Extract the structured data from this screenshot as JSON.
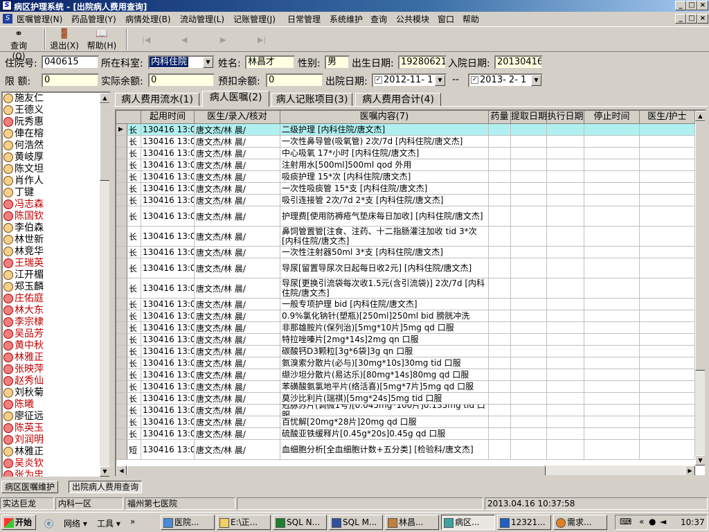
{
  "window": {
    "title": "病区护理系统 - [出院病人费用查询]",
    "controls": [
      "_",
      "□",
      "×"
    ]
  },
  "menu": [
    "医嘱管理(N)",
    "药品管理(Y)",
    "病情处理(B)",
    "流动管理(L)",
    "记账管理(J)",
    "日常管理",
    "系统维护",
    "查询",
    "公共模块",
    "窗口",
    "帮助"
  ],
  "toolbar": {
    "query": "查询(Q)",
    "exit": "退出(X)",
    "help": "帮助(H)"
  },
  "form": {
    "admission_no_label": "住院号:",
    "admission_no": "040615",
    "dept_label": "所在科室:",
    "dept": "内科住院",
    "name_label": "姓名:",
    "name": "林昌才",
    "sex_label": "性别:",
    "sex": "男",
    "birth_label": "出生日期:",
    "birth": "19280621",
    "admit_label": "入院日期:",
    "admit": "20130416",
    "limit_label": "限    额:",
    "limit": "0",
    "balance_label": "实际余额:",
    "balance": "0",
    "prebalance_label": "预扣余额:",
    "prebalance": "0",
    "discharge_label": "出院日期:",
    "discharge_from": "2012-11- 1",
    "range_sep": "--",
    "discharge_to": "2013- 2- 1"
  },
  "patients": [
    {
      "name": "施友仁",
      "color": "#000000",
      "female": false
    },
    {
      "name": "王德义",
      "color": "#000000",
      "female": false
    },
    {
      "name": "阮秀惠",
      "color": "#000000",
      "female": true
    },
    {
      "name": "俥在榕",
      "color": "#000000",
      "female": false
    },
    {
      "name": "何浩然",
      "color": "#000000",
      "female": false
    },
    {
      "name": "黄岐厚",
      "color": "#000000",
      "female": false
    },
    {
      "name": "陈文坦",
      "color": "#000000",
      "female": false
    },
    {
      "name": "肖作人",
      "color": "#000000",
      "female": false
    },
    {
      "name": "丁键",
      "color": "#000000",
      "female": false
    },
    {
      "name": "冯志森",
      "color": "#c00000",
      "female": true
    },
    {
      "name": "陈国钦",
      "color": "#c00000",
      "female": true
    },
    {
      "name": "李伯森",
      "color": "#000000",
      "female": false
    },
    {
      "name": "林世新",
      "color": "#000000",
      "female": false
    },
    {
      "name": "林竞华",
      "color": "#000000",
      "female": false
    },
    {
      "name": "王瑞英",
      "color": "#c00000",
      "female": true
    },
    {
      "name": "江开楣",
      "color": "#000000",
      "female": false
    },
    {
      "name": "郑玉麟",
      "color": "#000000",
      "female": false
    },
    {
      "name": "庄佑庭",
      "color": "#c00000",
      "female": true
    },
    {
      "name": "林大东",
      "color": "#c00000",
      "female": true
    },
    {
      "name": "李宗棣",
      "color": "#c00000",
      "female": true
    },
    {
      "name": "吴品芳",
      "color": "#c00000",
      "female": true
    },
    {
      "name": "黄中秋",
      "color": "#c00000",
      "female": true
    },
    {
      "name": "林雅正",
      "color": "#c00000",
      "female": true
    },
    {
      "name": "张映萍",
      "color": "#c00000",
      "female": true
    },
    {
      "name": "赵秀仙",
      "color": "#c00000",
      "female": true
    },
    {
      "name": "刘秋菊",
      "color": "#000000",
      "female": false
    },
    {
      "name": "陈曦",
      "color": "#c00000",
      "female": true
    },
    {
      "name": "廖征远",
      "color": "#000000",
      "female": false
    },
    {
      "name": "陈英玉",
      "color": "#c00000",
      "female": true
    },
    {
      "name": "刘润明",
      "color": "#c00000",
      "female": true
    },
    {
      "name": "林雅正",
      "color": "#000000",
      "female": false
    },
    {
      "name": "吴炎钦",
      "color": "#c00000",
      "female": true
    },
    {
      "name": "张为忠",
      "color": "#c00000",
      "female": true
    }
  ],
  "tabs": [
    "病人费用流水(1)",
    "病人医嘱(2)",
    "病人记账项目(3)",
    "病人费用合计(4)"
  ],
  "grid": {
    "headers": [
      "起用时间",
      "医生/录入/核对",
      "医嘱内容(7)",
      "药量",
      "提取日期",
      "执行日期",
      "停止时间",
      "医生/护士"
    ],
    "rows": [
      {
        "type": "长",
        "time": "130416 13:00",
        "doctor": "唐文杰/林  晨/",
        "content": "二级护理   [内科住院/唐文杰]"
      },
      {
        "type": "长",
        "time": "130416 13:00",
        "doctor": "唐文杰/林  晨/",
        "content": "一次性鼻导管(吸氧管) 2次/7d  [内科住院/唐文杰]"
      },
      {
        "type": "长",
        "time": "130416 13:00",
        "doctor": "唐文杰/林  晨/",
        "content": "中心吸氧  17*小时 [内科住院/唐文杰]"
      },
      {
        "type": "长",
        "time": "130416 13:00",
        "doctor": "唐文杰/林  晨/",
        "content": "注射用水[500ml]500ml qod 外用"
      },
      {
        "type": "长",
        "time": "130416 13:00",
        "doctor": "唐文杰/林  晨/",
        "content": "吸痰护理  15*次 [内科住院/唐文杰]"
      },
      {
        "type": "长",
        "time": "130416 13:00",
        "doctor": "唐文杰/林  晨/",
        "content": "一次性吸痰管  15*支 [内科住院/唐文杰]"
      },
      {
        "type": "长",
        "time": "130416 13:00",
        "doctor": "唐文杰/林  晨/",
        "content": "吸引连接管 2次/7d 2*支 [内科住院/唐文杰]"
      },
      {
        "type": "长",
        "time": "130416 13:00",
        "doctor": "唐文杰/林  晨/",
        "content": "护理费[使用防褥疮气垫床每日加收] [内科住院/唐文杰]"
      },
      {
        "type": "长",
        "time": "130416 13:00",
        "doctor": "唐文杰/林  晨/",
        "content": "鼻饲管置管[注食、注药、十二指肠灌注加收 tid 3*次 [内科住院/唐文杰]"
      },
      {
        "type": "长",
        "time": "130416 13:00",
        "doctor": "唐文杰/林  晨/",
        "content": "一次性注射器50ml  3*支 [内科住院/唐文杰]"
      },
      {
        "type": "长",
        "time": "130416 13:00",
        "doctor": "唐文杰/林  晨/",
        "content": "导尿[留置导尿次日起每日收2元]   [内科住院/唐文杰]"
      },
      {
        "type": "长",
        "time": "130416 13:00",
        "doctor": "唐文杰/林  晨/",
        "content": "导尿[更换引流袋每次收1.5元(含引流袋)] 2次/7d [内科住院/唐文杰]"
      },
      {
        "type": "长",
        "time": "130416 13:00",
        "doctor": "唐文杰/林  晨/",
        "content": "一般专项护理 bid  [内科住院/唐文杰]"
      },
      {
        "type": "长",
        "time": "130416 13:00",
        "doctor": "唐文杰/林  晨/",
        "content": "0.9%氯化钠针(塑瓶)[250ml]250ml bid 膀胱冲洗"
      },
      {
        "type": "长",
        "time": "130416 13:00",
        "doctor": "唐文杰/林  晨/",
        "content": "非那雄胺片(保列治)[5mg*10片]5mg qd 口服"
      },
      {
        "type": "长",
        "time": "130416 13:00",
        "doctor": "唐文杰/林  晨/",
        "content": "特拉唑嗪片[2mg*14s]2mg qn 口服"
      },
      {
        "type": "长",
        "time": "130416 13:00",
        "doctor": "唐文杰/林  晨/",
        "content": "碳酸钙D3颗粒[3g*6袋]3g qn 口服"
      },
      {
        "type": "长",
        "time": "130416 13:00",
        "doctor": "唐文杰/林  晨/",
        "content": "氨溴索分散片(必与)[30mg*10s]30mg tid 口服"
      },
      {
        "type": "长",
        "time": "130416 13:00",
        "doctor": "唐文杰/林  晨/",
        "content": "缬沙坦分散片(易达乐)[80mg*14s]80mg qd 口服"
      },
      {
        "type": "长",
        "time": "130416 13:00",
        "doctor": "唐文杰/林  晨/",
        "content": "苯磺酸氨氯地平片(络活喜)[5mg*7片]5mg qd 口服"
      },
      {
        "type": "长",
        "time": "130416 13:00",
        "doctor": "唐文杰/林  晨/",
        "content": "莫沙比利片(瑞祺)[5mg*24s]5mg tid 口服"
      },
      {
        "type": "长",
        "time": "130416 13:00",
        "doctor": "唐文杰/林  晨/",
        "content": "冠脉苏片(调微1号)[0.045mg*100片]0.135mg tid 口服"
      },
      {
        "type": "长",
        "time": "130416 13:00",
        "doctor": "唐文杰/林  晨/",
        "content": "百忧解[20mg*28片]20mg qd 口服"
      },
      {
        "type": "长",
        "time": "130416 13:00",
        "doctor": "唐文杰/林  晨/",
        "content": "硫酸亚铁缓释片[0.45g*20s]0.45g qd 口服"
      },
      {
        "type": "短",
        "time": "130416 13:00",
        "doctor": "唐文杰/林  晨/",
        "content": "血细胞分析[全血细胞计数+五分类]   [检验科/唐文杰]"
      }
    ]
  },
  "bottom_tabs": [
    "病区医嘱维护",
    "出院病人费用查询"
  ],
  "status": {
    "user": "实达巨龙",
    "dept": "内科一区",
    "hospital": "福州第七医院",
    "datetime": "2013.04.16 10:37:58"
  },
  "taskbar": {
    "start": "开始",
    "network": "网络",
    "tools": "工具",
    "items": [
      "医院...",
      "E:\\正...",
      "SQL N...",
      "SQL M...",
      "林昌...",
      "病区...",
      "12321...",
      "需求..."
    ],
    "clock": "10:37"
  },
  "colors": {
    "title_gradient_start": "#0a246a",
    "selected_row": "#b0f0f0",
    "field_bg": "#ffffe1",
    "female_name": "#c00000"
  }
}
